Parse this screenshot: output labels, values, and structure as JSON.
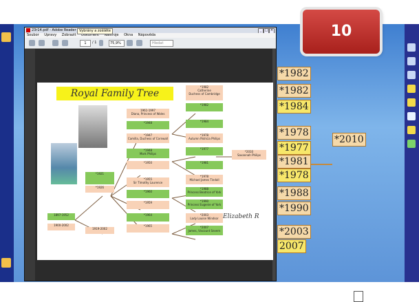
{
  "slide_number": "10",
  "reader": {
    "title": "23r14.pdf - Adobe Reader",
    "window_buttons": [
      "_",
      "□",
      "×"
    ],
    "menu": [
      "Soubor",
      "Úpravy",
      "Zobrazit",
      "Dokument",
      "Nástroje",
      "Okna",
      "Nápověda"
    ],
    "page_field": "1",
    "page_total": "/ 1",
    "zoom_value": "75,9%",
    "find_placeholder": "Hledat",
    "tooltip": "Vybrány a zoššěte"
  },
  "tree": {
    "title": "Royal Family Tree",
    "nodes": [
      {
        "id": "n1952",
        "text": "1897-1952",
        "color": "green"
      },
      {
        "id": "n1900",
        "text": "1900-2002",
        "color": "pink"
      },
      {
        "id": "n1926",
        "text": "*1926",
        "color": "pink"
      },
      {
        "id": "n1921",
        "text": "*1921",
        "color": "green"
      },
      {
        "id": "nph",
        "text": "1919-2002",
        "color": "pink"
      },
      {
        "id": "diana",
        "text": "1961-1997\nDiana, Princess of Wales",
        "color": "pink"
      },
      {
        "id": "charles",
        "text": "*1948",
        "color": "green"
      },
      {
        "id": "camilla",
        "text": "*1947\nCamilla, Duchess of Cornwall",
        "color": "pink"
      },
      {
        "id": "mark",
        "text": "*1948\nMark Philips",
        "color": "green"
      },
      {
        "id": "anne",
        "text": "*1950",
        "color": "pink"
      },
      {
        "id": "tim",
        "text": "*1955\nSir Timothy Laurence",
        "color": "pink"
      },
      {
        "id": "andrew",
        "text": "*1960",
        "color": "green"
      },
      {
        "id": "sarah",
        "text": "*1959",
        "color": "pink"
      },
      {
        "id": "edward",
        "text": "*1964",
        "color": "green"
      },
      {
        "id": "sophie",
        "text": "*1965",
        "color": "pink"
      },
      {
        "id": "catherine",
        "text": "*1982\nCatherine\nDuchess of Cambridge",
        "color": "pink"
      },
      {
        "id": "william",
        "text": "*1982",
        "color": "green"
      },
      {
        "id": "harry",
        "text": "*1984",
        "color": "green"
      },
      {
        "id": "autumn",
        "text": "*1978\nAutumn Patricia Philips",
        "color": "pink"
      },
      {
        "id": "peter",
        "text": "*1977",
        "color": "green"
      },
      {
        "id": "zara",
        "text": "*1981",
        "color": "green"
      },
      {
        "id": "mike",
        "text": "*1978\nMichael James Tindall",
        "color": "pink"
      },
      {
        "id": "beatrice",
        "text": "*1988\nPrincess Beatrice of York",
        "color": "green"
      },
      {
        "id": "eugenie",
        "text": "*1990\nPrincess Eugenie of York",
        "color": "green"
      },
      {
        "id": "louise",
        "text": "*2003\nLady Louise Windsor",
        "color": "pink"
      },
      {
        "id": "james",
        "text": "*2007\nJames, Viscount Severn",
        "color": "green"
      },
      {
        "id": "savannah",
        "text": "*2010\nSavannah Philips",
        "color": "pink"
      }
    ],
    "signature": "Elizabeth R"
  },
  "years": [
    "*1982",
    "*1982",
    "*1984",
    "*1978",
    "*1977",
    "*1981",
    "*1978",
    "*1988",
    "*1990",
    "*2003",
    "2007",
    "*2010"
  ],
  "colors": {
    "accent_red": "#c0312c",
    "tree_green": "#86c95a",
    "tree_pink": "#f8d2b7",
    "title_yellow": "#f7f21a",
    "desktop_blue": "#5d94d8"
  }
}
